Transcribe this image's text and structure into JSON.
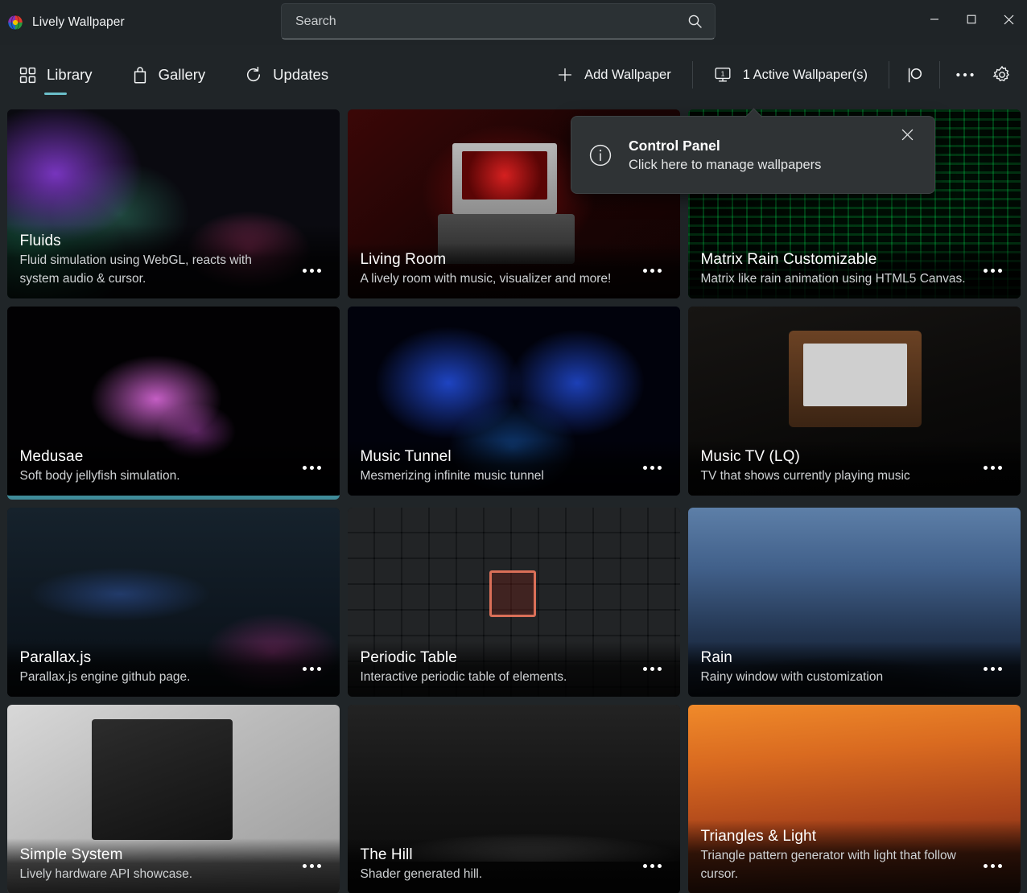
{
  "app": {
    "title": "Lively Wallpaper",
    "logo_icon": "lively-logo-icon"
  },
  "search": {
    "placeholder": "Search",
    "value": "",
    "icon": "search-icon"
  },
  "window_controls": {
    "minimize": "minimize-icon",
    "maximize": "maximize-icon",
    "close": "close-icon"
  },
  "nav": {
    "tabs": [
      {
        "label": "Library",
        "icon": "grid-icon",
        "active": true
      },
      {
        "label": "Gallery",
        "icon": "shopping-bag-icon",
        "active": false
      },
      {
        "label": "Updates",
        "icon": "refresh-icon",
        "active": false
      }
    ]
  },
  "toolbar": {
    "add_wallpaper_label": "Add Wallpaper",
    "add_wallpaper_icon": "plus-icon",
    "active_wallpapers_label": "1 Active Wallpaper(s)",
    "active_wallpapers_count": "1",
    "active_wallpapers_icon": "monitor-icon",
    "patreon_icon": "patreon-icon",
    "more_icon": "more-horizontal-icon",
    "settings_icon": "gear-icon"
  },
  "teaching_tip": {
    "icon": "info-icon",
    "title": "Control Panel",
    "subtitle": "Click here to manage wallpapers",
    "close_icon": "close-icon"
  },
  "colors": {
    "accent": "#6bbfca",
    "active_card_border": "#3f8b99",
    "window_bg": "#202528",
    "titlebar_bg": "#1f2427",
    "tip_bg": "#2f3335"
  },
  "library": {
    "menu_icon": "more-horizontal-icon",
    "cards": [
      {
        "title": "Fluids",
        "description": "Fluid simulation using WebGL, reacts with system audio & cursor.",
        "thumb_class": "t-fluids",
        "active": false
      },
      {
        "title": "Living Room",
        "description": "A lively room with music, visualizer and more!",
        "thumb_class": "t-living",
        "active": false
      },
      {
        "title": "Matrix Rain Customizable",
        "description": "Matrix like rain animation using HTML5 Canvas.",
        "thumb_class": "t-matrix",
        "active": false
      },
      {
        "title": "Medusae",
        "description": "Soft body jellyfish simulation.",
        "thumb_class": "t-medusae",
        "active": true
      },
      {
        "title": "Music Tunnel",
        "description": "Mesmerizing infinite music tunnel",
        "thumb_class": "t-tunnel",
        "active": false
      },
      {
        "title": "Music TV (LQ)",
        "description": "TV that shows currently playing music",
        "thumb_class": "t-musictv",
        "active": false
      },
      {
        "title": "Parallax.js",
        "description": "Parallax.js engine github page.",
        "thumb_class": "t-parallax",
        "active": false
      },
      {
        "title": "Periodic Table",
        "description": "Interactive periodic table of elements.",
        "thumb_class": "t-periodic",
        "active": false
      },
      {
        "title": "Rain",
        "description": "Rainy window with customization",
        "thumb_class": "t-rain",
        "active": false
      },
      {
        "title": "Simple System",
        "description": "Lively hardware API showcase.",
        "thumb_class": "t-simple",
        "active": false
      },
      {
        "title": "The Hill",
        "description": "Shader generated hill.",
        "thumb_class": "t-hill",
        "active": false
      },
      {
        "title": "Triangles & Light",
        "description": "Triangle pattern generator with light that follow cursor.",
        "thumb_class": "t-triangles",
        "active": false
      }
    ]
  }
}
